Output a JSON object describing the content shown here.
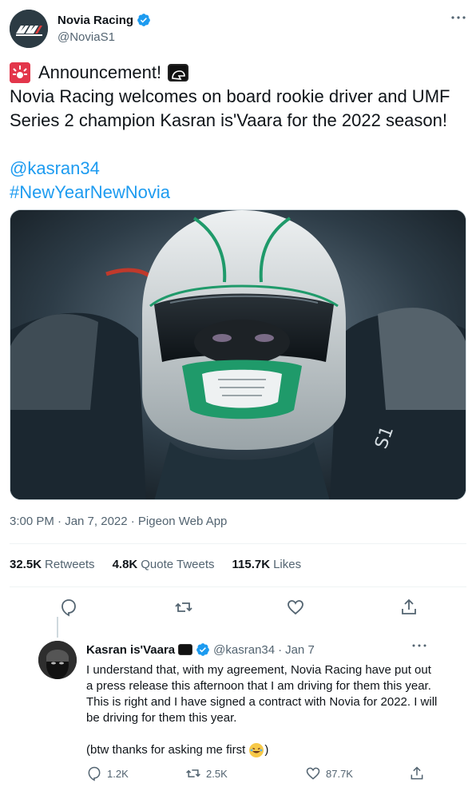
{
  "tweet": {
    "author_name": "Novia Racing",
    "author_handle": "@NoviaS1",
    "line1": "Announcement!",
    "line2": "Novia Racing welcomes on board rookie driver and UMF",
    "line3": "Series 2 champion Kasran is'Vaara for the 2022 season!",
    "mention": "@kasran34",
    "hashtag": "#NewYearNewNovia",
    "timestamp": "3:00 PM · Jan 7, 2022 · Pigeon Web App",
    "stats": {
      "retweets_count": "32.5K",
      "retweets_label": "Retweets",
      "quotes_count": "4.8K",
      "quotes_label": "Quote Tweets",
      "likes_count": "115.7K",
      "likes_label": "Likes"
    }
  },
  "reply": {
    "author_name": "Kasran is'Vaara",
    "author_handle": "@kasran34",
    "dot": "·",
    "date": "Jan 7",
    "paragraph1": "I understand that, with my agreement, Novia Racing have put out a press release this afternoon that I am driving for them this year. This is right and I have signed a contract with Novia for 2022. I will be driving for them this year.",
    "paragraph2_before": "(btw thanks for asking me first",
    "paragraph2_after": ")",
    "replies": "1.2K",
    "retweets": "2.5K",
    "likes": "87.7K"
  },
  "colors": {
    "accent": "#1d9bf0",
    "secondary_text": "#536471",
    "primary_text": "#0f1419",
    "helmet_green": "#1f9a6a"
  },
  "icons": [
    "verified-badge-icon",
    "more-icon",
    "siren-emoji-icon",
    "helmet-emoji-icon",
    "reply-icon",
    "retweet-icon",
    "like-icon",
    "share-icon",
    "laughing-emoji-icon"
  ]
}
